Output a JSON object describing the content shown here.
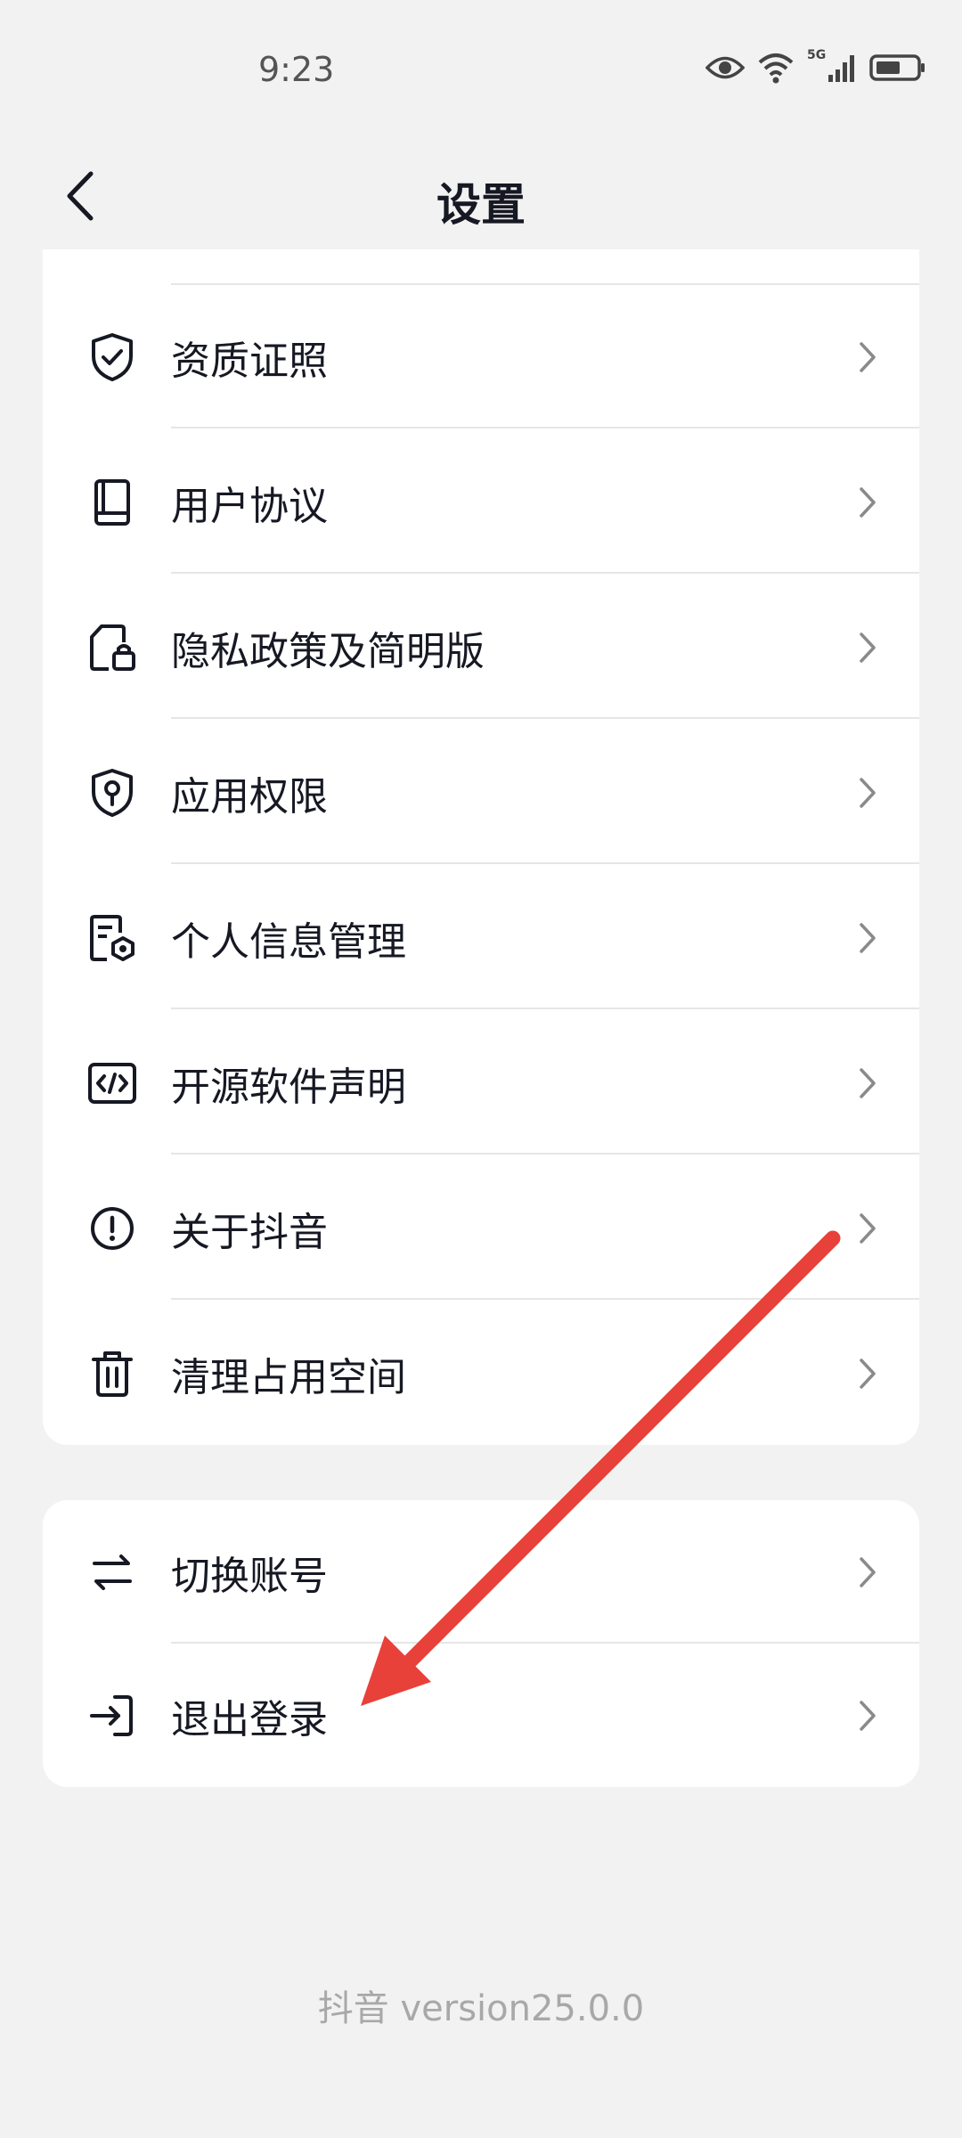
{
  "status_bar": {
    "time": "9:23",
    "network": "5G"
  },
  "nav": {
    "title": "设置"
  },
  "group1": [
    {
      "label": "资质证照",
      "icon": "shield-check-icon"
    },
    {
      "label": "用户协议",
      "icon": "book-icon"
    },
    {
      "label": "隐私政策及简明版",
      "icon": "document-lock-icon"
    },
    {
      "label": "应用权限",
      "icon": "shield-key-icon"
    },
    {
      "label": "个人信息管理",
      "icon": "document-gear-icon"
    },
    {
      "label": "开源软件声明",
      "icon": "code-icon"
    },
    {
      "label": "关于抖音",
      "icon": "info-circle-icon"
    },
    {
      "label": "清理占用空间",
      "icon": "trash-icon"
    }
  ],
  "group2": [
    {
      "label": "切换账号",
      "icon": "switch-arrows-icon"
    },
    {
      "label": "退出登录",
      "icon": "logout-icon"
    }
  ],
  "footer": {
    "version": "抖音 version25.0.0"
  },
  "colors": {
    "background": "#f2f2f2",
    "card": "#ffffff",
    "text": "#161823",
    "annotation_arrow": "#e8413a"
  }
}
